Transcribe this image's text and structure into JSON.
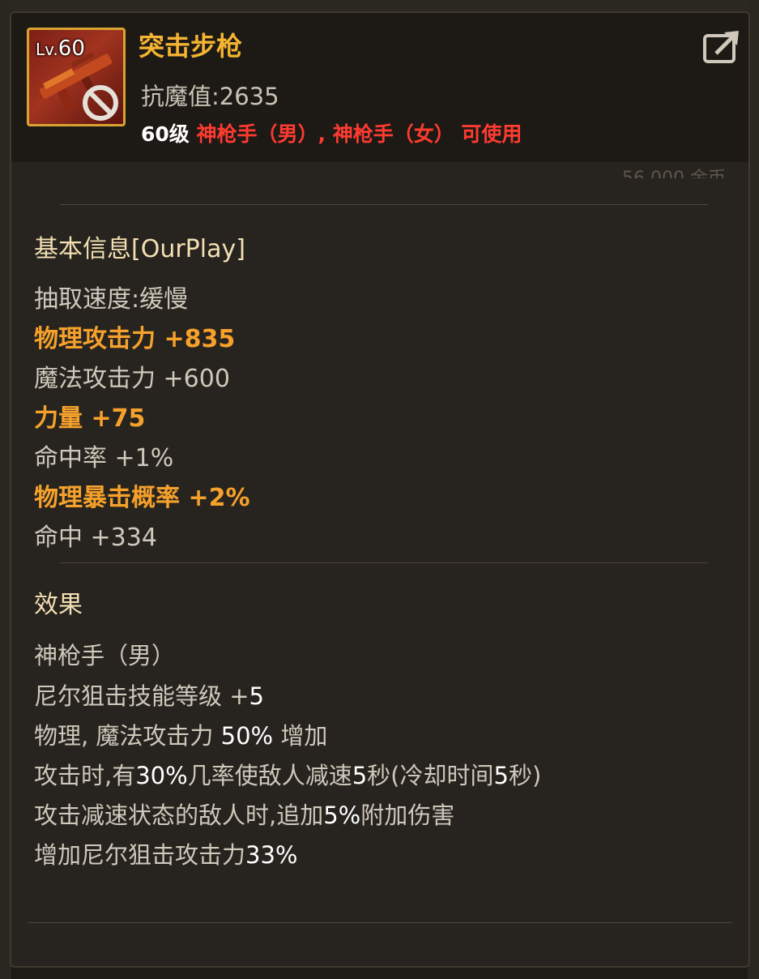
{
  "item": {
    "level_label": "Lv.",
    "level": "60",
    "name": "突击步枪",
    "resist": "抗魔值:2635",
    "requirement": {
      "level_text": "60级",
      "classes_text": "神枪手（男）, 神枪手（女） 可使用"
    }
  },
  "basic_info": {
    "title": "基本信息[OurPlay]",
    "stats": [
      {
        "text": "抽取速度:缓慢",
        "highlight": false
      },
      {
        "text": "物理攻击力 +835",
        "highlight": true
      },
      {
        "text": "魔法攻击力 +600",
        "highlight": false
      },
      {
        "text": "力量 +75",
        "highlight": true
      },
      {
        "text": "命中率 +1%",
        "highlight": false
      },
      {
        "text": "物理暴击概率 +2%",
        "highlight": true
      },
      {
        "text": "命中 +334",
        "highlight": false
      }
    ]
  },
  "effects": {
    "title": "效果",
    "lines": [
      [
        "神枪手（男）"
      ],
      [
        "尼尔狙击技能等级 +",
        "5"
      ],
      [
        "物理, 魔法攻击力 ",
        "50%",
        " 增加"
      ],
      [
        "攻击时,有",
        "30%",
        "几率使敌人减速",
        "5",
        "秒(冷却时间",
        "5",
        "秒)"
      ],
      [
        "攻击减速状态的敌人时,追加",
        "5%",
        "附加伤害"
      ],
      [
        "增加尼尔狙击攻击力",
        "33%"
      ]
    ]
  },
  "colors": {
    "name": "#f5b431",
    "highlight_stat": "#f6a12b",
    "class_requirement": "#ff3b30",
    "frame": "#d9a231"
  },
  "icons": {
    "item": "rifle-icon",
    "unusable": "prohibited-icon",
    "share": "share-icon"
  }
}
